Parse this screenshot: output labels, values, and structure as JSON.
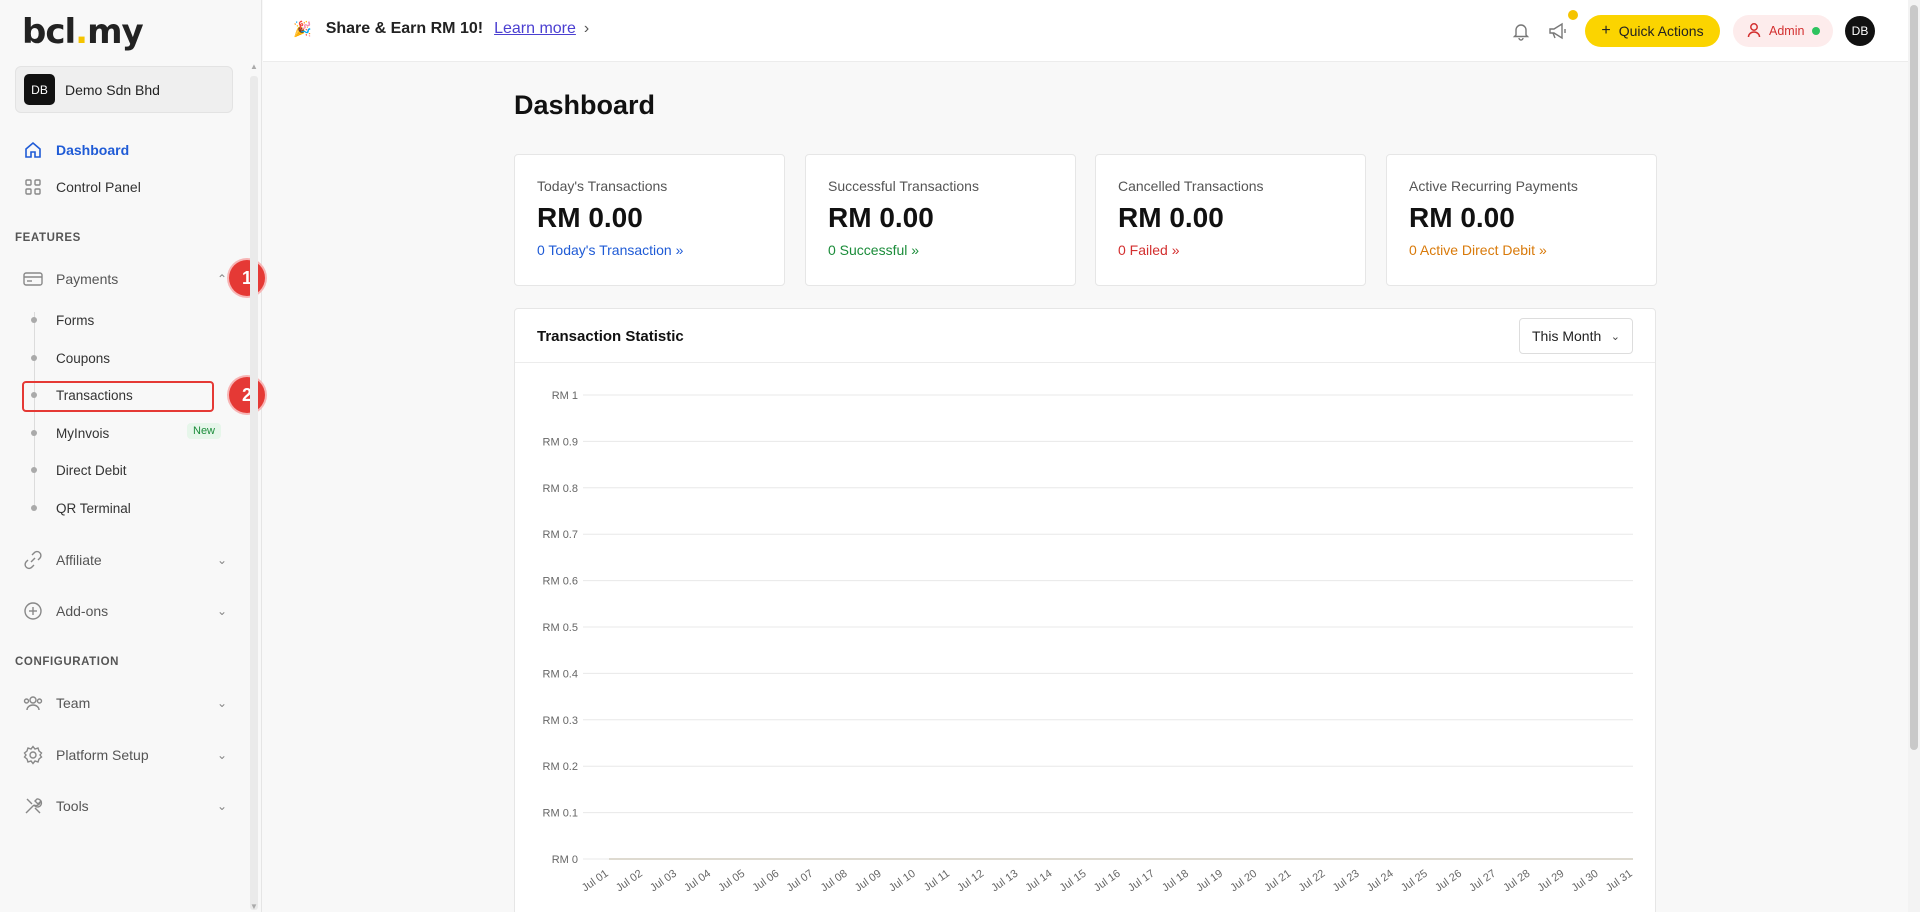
{
  "sidebar": {
    "logo": {
      "main": "bcl",
      "dot": ".",
      "tail": "my"
    },
    "workspace": {
      "initials": "DB",
      "name": "Demo Sdn Bhd"
    },
    "nav": {
      "dashboard": "Dashboard",
      "control_panel": "Control Panel"
    },
    "sections": {
      "features": "FEATURES",
      "configuration": "CONFIGURATION"
    },
    "payments": {
      "label": "Payments",
      "items": [
        "Forms",
        "Coupons",
        "Transactions",
        "MyInvois",
        "Direct Debit",
        "QR Terminal"
      ],
      "badge": "New"
    },
    "affiliate": "Affiliate",
    "addons": "Add-ons",
    "team": "Team",
    "platform_setup": "Platform Setup",
    "tools": "Tools",
    "annotations": [
      "1",
      "2"
    ]
  },
  "topbar": {
    "share_text": "Share & Earn RM 10!",
    "learn_more": "Learn more",
    "quick_actions": "Quick Actions",
    "admin": "Admin",
    "user_initials": "DB"
  },
  "main": {
    "title": "Dashboard",
    "cards": [
      {
        "title": "Today's Transactions",
        "value": "RM 0.00",
        "link": "0 Today's Transaction »",
        "color": "#1f5bd6"
      },
      {
        "title": "Successful Transactions",
        "value": "RM 0.00",
        "link": "0 Successful »",
        "color": "#1b8c3a"
      },
      {
        "title": "Cancelled Transactions",
        "value": "RM 0.00",
        "link": "0 Failed »",
        "color": "#d32f2f"
      },
      {
        "title": "Active Recurring Payments",
        "value": "RM 0.00",
        "link": "0 Active Direct Debit »",
        "color": "#d97a0a"
      }
    ],
    "statistic": {
      "title": "Transaction Statistic",
      "range": "This Month"
    }
  },
  "chart_data": {
    "type": "line",
    "title": "",
    "y_ticks": [
      "RM 1",
      "RM 0.9",
      "RM 0.8",
      "RM 0.7",
      "RM 0.6",
      "RM 0.5",
      "RM 0.4",
      "RM 0.3",
      "RM 0.2",
      "RM 0.1",
      "RM 0"
    ],
    "ylim": [
      0,
      1
    ],
    "categories": [
      "Jul 01",
      "Jul 02",
      "Jul 03",
      "Jul 04",
      "Jul 05",
      "Jul 06",
      "Jul 07",
      "Jul 08",
      "Jul 09",
      "Jul 10",
      "Jul 11",
      "Jul 12",
      "Jul 13",
      "Jul 14",
      "Jul 15",
      "Jul 16",
      "Jul 17",
      "Jul 18",
      "Jul 19",
      "Jul 20",
      "Jul 21",
      "Jul 22",
      "Jul 23",
      "Jul 24",
      "Jul 25",
      "Jul 26",
      "Jul 27",
      "Jul 28",
      "Jul 29",
      "Jul 30",
      "Jul 31"
    ],
    "series": [
      {
        "values": [
          0,
          0,
          0,
          0,
          0,
          0,
          0,
          0,
          0,
          0,
          0,
          0,
          0,
          0,
          0,
          0,
          0,
          0,
          0,
          0,
          0,
          0,
          0,
          0,
          0,
          0,
          0,
          0,
          0,
          0,
          0
        ],
        "color": "#2ec35f"
      },
      {
        "values": [
          0,
          0,
          0,
          0,
          0,
          0,
          0,
          0,
          0,
          0,
          0,
          0,
          0,
          0,
          0,
          0,
          0,
          0,
          0,
          0,
          0,
          0,
          0,
          0,
          0,
          0,
          0,
          0,
          0,
          0,
          0
        ],
        "color": "#e53935"
      }
    ],
    "grid": true
  }
}
